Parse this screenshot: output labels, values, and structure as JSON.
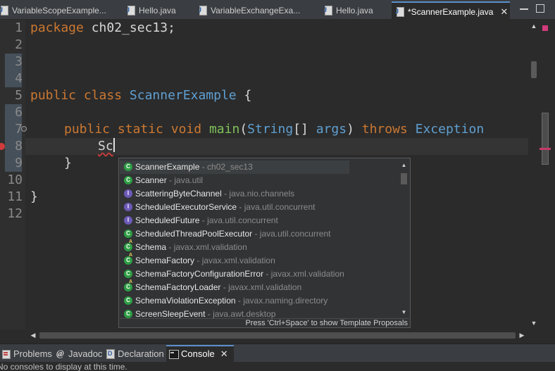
{
  "window": {
    "tabs": [
      {
        "label": "VariableScopeExample..."
      },
      {
        "label": "Hello.java"
      },
      {
        "label": "VariableExchangeExa..."
      },
      {
        "label": "Hello.java"
      },
      {
        "label": "*ScannerExample.java"
      }
    ],
    "active_tab_index": 4
  },
  "editor": {
    "line_numbers": [
      "1",
      "2",
      "3",
      "4",
      "5",
      "6",
      "7",
      "8",
      "9",
      "10",
      "11",
      "12"
    ],
    "code": {
      "l1_kw": "package",
      "l1_rest": " ch02_sec13;",
      "l5_kw1": "public",
      "l5_kw2": "class",
      "l5_cls": "ScannerExample",
      "l5_rest": " {",
      "l7_kw1": "public",
      "l7_kw2": "static",
      "l7_kw3": "void",
      "l7_fn": "main",
      "l7_p1": "(",
      "l7_type": "String",
      "l7_p2": "[] ",
      "l7_arg": "args",
      "l7_p3": ") ",
      "l7_kw4": "throws",
      "l7_exc": "Exception",
      "l8_typed": "Sc",
      "l9_close": "}",
      "l11_close": "}"
    }
  },
  "content_assist": {
    "proposals": [
      {
        "name": "ScannerExample",
        "pkg": " - ch02_sec13",
        "kind": "class"
      },
      {
        "name": "Scanner",
        "pkg": " - java.util",
        "kind": "class"
      },
      {
        "name": "ScatteringByteChannel",
        "pkg": " - java.nio.channels",
        "kind": "interface"
      },
      {
        "name": "ScheduledExecutorService",
        "pkg": " - java.util.concurrent",
        "kind": "interface"
      },
      {
        "name": "ScheduledFuture",
        "pkg": " - java.util.concurrent",
        "kind": "interface"
      },
      {
        "name": "ScheduledThreadPoolExecutor",
        "pkg": " - java.util.concurrent",
        "kind": "class"
      },
      {
        "name": "Schema",
        "pkg": " - javax.xml.validation",
        "kind": "abstract-class"
      },
      {
        "name": "SchemaFactory",
        "pkg": " - javax.xml.validation",
        "kind": "abstract-class"
      },
      {
        "name": "SchemaFactoryConfigurationError",
        "pkg": " - javax.xml.validation",
        "kind": "class"
      },
      {
        "name": "SchemaFactoryLoader",
        "pkg": " - javax.xml.validation",
        "kind": "abstract-class"
      },
      {
        "name": "SchemaViolationException",
        "pkg": " - javax.naming.directory",
        "kind": "class"
      },
      {
        "name": "ScreenSleepEvent",
        "pkg": " - java.awt.desktop",
        "kind": "class"
      }
    ],
    "footer": "Press 'Ctrl+Space' to show Template Proposals"
  },
  "bottom_panel": {
    "tabs": [
      {
        "label": "Problems",
        "icon": "problems-icon"
      },
      {
        "label": "Javadoc",
        "icon": "javadoc-icon"
      },
      {
        "label": "Declaration",
        "icon": "declaration-icon"
      },
      {
        "label": "Console",
        "icon": "console-icon"
      }
    ],
    "console_message": "No consoles to display at this time."
  },
  "colors": {
    "background": "#2b2b2b",
    "keyword": "#cc7832",
    "class": "#5f9fd1",
    "method": "#7fc15a",
    "error": "#d23b3b",
    "accent": "#5a8fc9"
  }
}
